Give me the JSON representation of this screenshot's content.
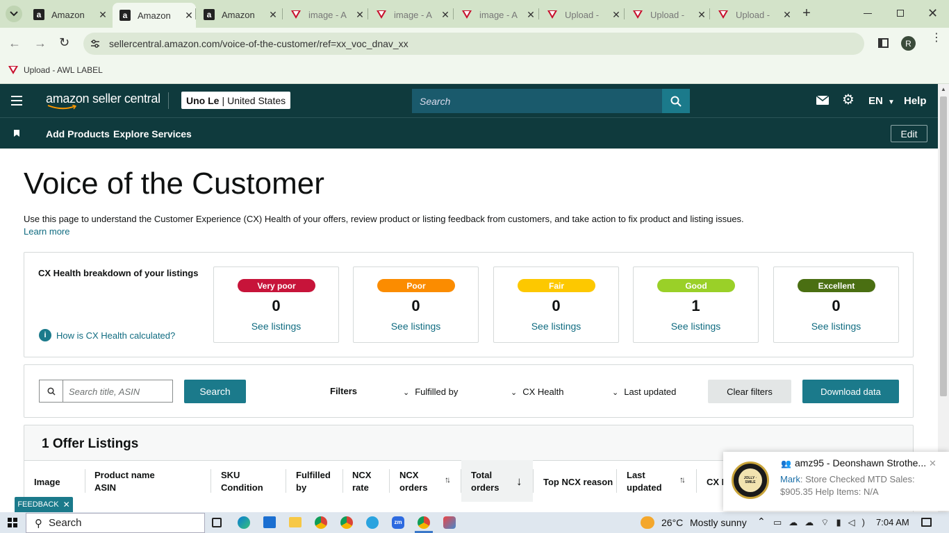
{
  "browser": {
    "tabs": [
      {
        "title": "Amazon",
        "favicon": "amazon-a"
      },
      {
        "title": "Amazon",
        "favicon": "amazon-a",
        "active": true
      },
      {
        "title": "Amazon",
        "favicon": "amazon-a"
      },
      {
        "title": "image - A",
        "favicon": "awl-v"
      },
      {
        "title": "image - A",
        "favicon": "awl-v"
      },
      {
        "title": "image - A",
        "favicon": "awl-v"
      },
      {
        "title": "Upload - ",
        "favicon": "awl-v"
      },
      {
        "title": "Upload - ",
        "favicon": "awl-v"
      },
      {
        "title": "Upload - ",
        "favicon": "awl-v"
      }
    ],
    "new_tab": "+",
    "url": "sellercentral.amazon.com/voice-of-the-customer/ref=xx_voc_dnav_xx",
    "profile_initial": "R",
    "bookmark": "Upload - AWL LABEL"
  },
  "header": {
    "logo_text": "amazon seller central",
    "account_name": "Uno Le",
    "account_region": "United States",
    "search_placeholder": "Search",
    "lang": "EN",
    "help": "Help"
  },
  "subnav": {
    "items": [
      "Add Products",
      "Explore Services"
    ],
    "edit": "Edit"
  },
  "page": {
    "title": "Voice of the Customer",
    "description": "Use this page to understand the Customer Experience (CX) Health of your offers, review product or listing feedback from customers, and take action to fix product and listing issues.",
    "learn_more": "Learn more"
  },
  "cx": {
    "heading": "CX Health breakdown of your listings",
    "how_link": "How is CX Health calculated?",
    "cards": [
      {
        "label": "Very poor",
        "count": "0",
        "link": "See listings",
        "color": "#c7143a",
        "text_color": "#ffffff"
      },
      {
        "label": "Poor",
        "count": "0",
        "link": "See listings",
        "color": "#fb8c00",
        "text_color": "#ffffff"
      },
      {
        "label": "Fair",
        "count": "0",
        "link": "See listings",
        "color": "#fdc800",
        "text_color": "#ffffff"
      },
      {
        "label": "Good",
        "count": "1",
        "link": "See listings",
        "color": "#9ad028",
        "text_color": "#ffffff"
      },
      {
        "label": "Excellent",
        "count": "0",
        "link": "See listings",
        "color": "#4a6f12",
        "text_color": "#ffffff"
      }
    ]
  },
  "filters": {
    "search_placeholder": "Search title, ASIN",
    "search_button": "Search",
    "label": "Filters",
    "dropdowns": [
      "Fulfilled by",
      "CX Health",
      "Last updated"
    ],
    "clear": "Clear filters",
    "download": "Download data"
  },
  "listings": {
    "title": "1 Offer Listings",
    "columns": [
      {
        "l1": "Image",
        "l2": ""
      },
      {
        "l1": "Product name",
        "l2": "ASIN"
      },
      {
        "l1": "SKU",
        "l2": "Condition"
      },
      {
        "l1": "Fulfilled",
        "l2": "by"
      },
      {
        "l1": "NCX",
        "l2": "rate"
      },
      {
        "l1": "NCX",
        "l2": "orders"
      },
      {
        "l1": "Total",
        "l2": "orders"
      },
      {
        "l1": "Top NCX reason",
        "l2": ""
      },
      {
        "l1": "Last",
        "l2": "updated"
      },
      {
        "l1": "CX H",
        "l2": ""
      }
    ]
  },
  "feedback_tab": "FEEDBACK",
  "notification": {
    "title": "amz95 - Deonshawn Strothe...",
    "sender": "Mark",
    "message": ": Store Checked MTD Sales: $905.35 Help Items: N/A",
    "avatar_text": "JOLLY · SMILE"
  },
  "taskbar": {
    "search": "Search",
    "weather_temp": "26°C",
    "weather_text": "Mostly sunny",
    "time": "7:04 AM"
  }
}
